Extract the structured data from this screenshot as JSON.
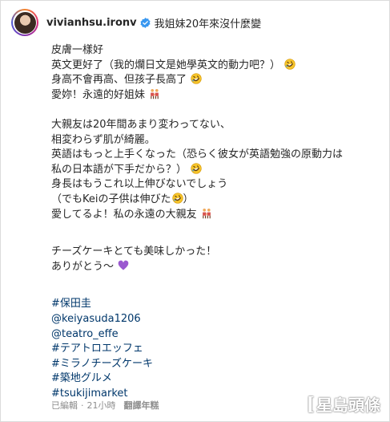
{
  "post": {
    "username": "vivianhsu.ironv",
    "header_caption": "我姐妹20年來沒什麼變"
  },
  "caption_lines": {
    "l1": "皮膚一樣好",
    "l2": "英文更好了（我的爛日文是她學英文的動力吧？）",
    "l3": "身高不會再高、但孩子長高了",
    "l4": "愛妳！永遠的好姐妹",
    "l5": "大親友は20年間あまり変わってない、",
    "l6": "相変わらず肌が綺麗。",
    "l7": "英語はもっと上手くなった（恐らく彼女が英語勉強の原動力は",
    "l8": "私の日本語が下手だから？）",
    "l9": "身長はもうこれ以上伸びないでしょう",
    "l10": "（でもKeiの子供は伸びた",
    "l10_end": "）",
    "l11": "愛してるよ！私の永遠の大親友",
    "l12": "チーズケーキとても美味しかった！",
    "l13": "ありがとう～"
  },
  "tags": [
    "#保田圭",
    "@keiyasuda1206",
    "@teatro_effe",
    "#テアトロエッフェ",
    "#ミラノチーズケーキ",
    "#築地グルメ",
    "#tsukijimarket"
  ],
  "meta": {
    "edited": "已編輯",
    "dot": "·",
    "time": "21小時",
    "translate": "翻譯年糕"
  },
  "watermark": {
    "text": "星島頭條"
  },
  "icons": {
    "verified": "verified-badge-icon",
    "laugh": "rolling-laughing-emoji-icon",
    "couple": "women-holding-hands-emoji-icon",
    "heart": "purple-heart-emoji-icon"
  },
  "colors": {
    "link": "#00376b",
    "verified": "#3897f0",
    "meta": "#8e8e8e"
  }
}
